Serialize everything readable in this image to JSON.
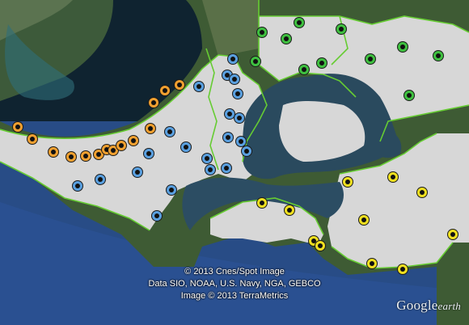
{
  "credits": {
    "line1": "© 2013 Cnes/Spot Image",
    "line2": "Data SIO, NOAA, U.S. Navy, NGA, GEBCO",
    "line3": "Image © 2013 TerraMetrics"
  },
  "logo": {
    "google": "Google",
    "earth": "earth"
  },
  "colors": {
    "orange": "#f0a030",
    "blue": "#5aa0e0",
    "green": "#3fc040",
    "yellow": "#f0e020",
    "district_fill": "#d9d9d9",
    "boundary": "#66cc33"
  }
}
